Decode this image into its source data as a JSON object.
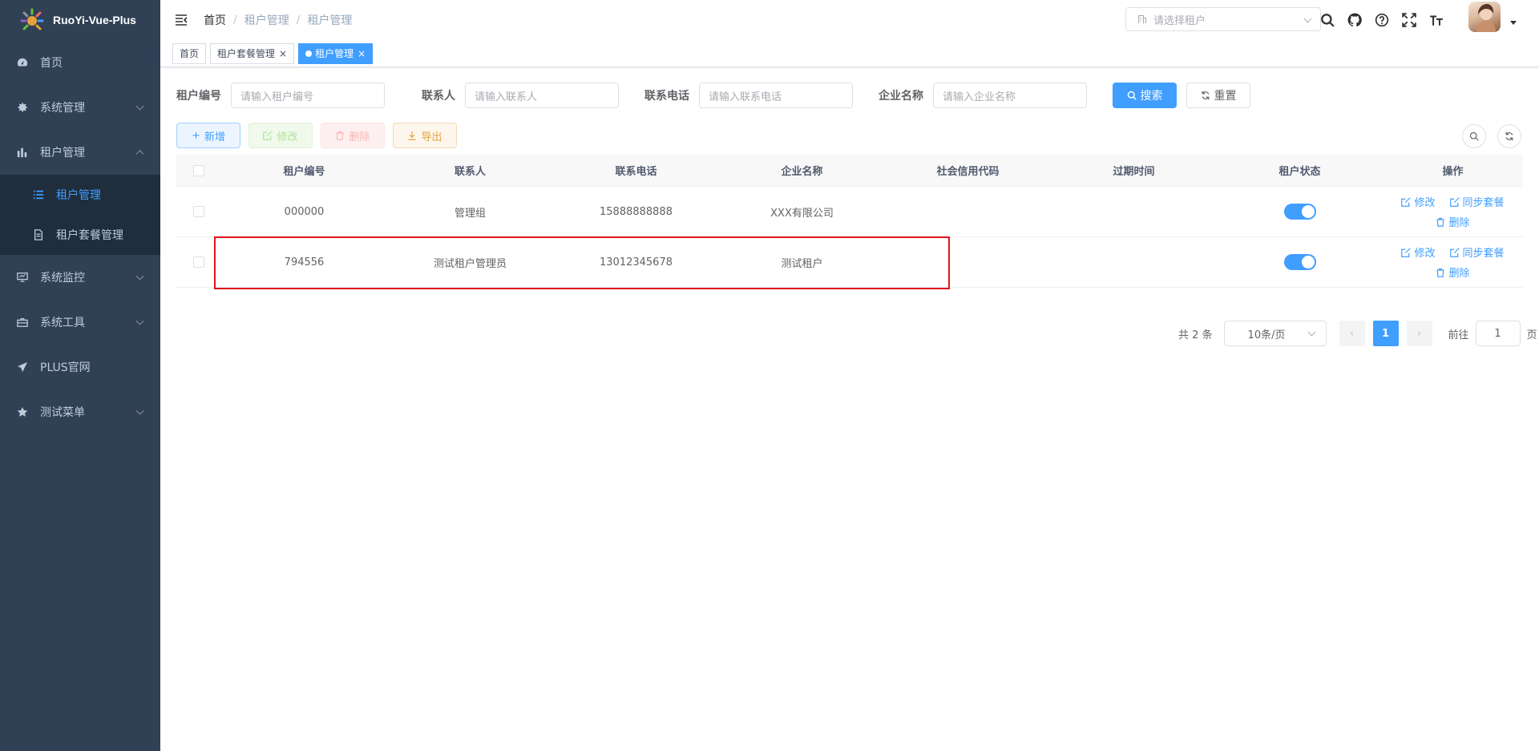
{
  "app": {
    "name": "RuoYi-Vue-Plus"
  },
  "sidebar": {
    "items": [
      {
        "label": "首页",
        "icon": "dashboard-icon"
      },
      {
        "label": "系统管理",
        "icon": "gear-icon"
      },
      {
        "label": "租户管理",
        "icon": "chart-icon",
        "expanded": true,
        "children": [
          {
            "label": "租户管理",
            "icon": "list-icon",
            "active": true
          },
          {
            "label": "租户套餐管理",
            "icon": "document-icon"
          }
        ]
      },
      {
        "label": "系统监控",
        "icon": "monitor-icon"
      },
      {
        "label": "系统工具",
        "icon": "toolbox-icon"
      },
      {
        "label": "PLUS官网",
        "icon": "send-icon"
      },
      {
        "label": "测试菜单",
        "icon": "star-icon"
      }
    ]
  },
  "header": {
    "breadcrumb": [
      "首页",
      "租户管理",
      "租户管理"
    ],
    "breadcrumb_sep": "/",
    "tenant_placeholder": "请选择租户"
  },
  "tags": [
    {
      "label": "首页"
    },
    {
      "label": "租户套餐管理",
      "closable": true
    },
    {
      "label": "租户管理",
      "closable": true,
      "active": true
    }
  ],
  "search": {
    "fields": [
      {
        "label": "租户编号",
        "placeholder": "请输入租户编号"
      },
      {
        "label": "联系人",
        "placeholder": "请输入联系人"
      },
      {
        "label": "联系电话",
        "placeholder": "请输入联系电话"
      },
      {
        "label": "企业名称",
        "placeholder": "请输入企业名称"
      }
    ],
    "search_label": "搜索",
    "reset_label": "重置"
  },
  "toolbar": {
    "add": "新增",
    "edit": "修改",
    "delete": "删除",
    "export": "导出"
  },
  "table": {
    "columns": [
      "租户编号",
      "联系人",
      "联系电话",
      "企业名称",
      "社会信用代码",
      "过期时间",
      "租户状态",
      "操作"
    ],
    "rows": [
      {
        "id": "000000",
        "contact": "管理组",
        "phone": "15888888888",
        "company": "XXX有限公司",
        "credit": "",
        "expire": "",
        "status": true
      },
      {
        "id": "794556",
        "contact": "测试租户管理员",
        "phone": "13012345678",
        "company": "测试租户",
        "credit": "",
        "expire": "",
        "status": true
      }
    ],
    "ops": {
      "edit": "修改",
      "sync": "同步套餐",
      "delete": "删除"
    }
  },
  "pagination": {
    "total_text": "共 2 条",
    "page_size": "10条/页",
    "current_page": "1",
    "goto_label": "前往",
    "goto_value": "1",
    "page_suffix": "页"
  },
  "colors": {
    "primary": "#409eff",
    "sidebar_bg": "#304156",
    "submenu_bg": "#1f2d3d",
    "highlight": "#e0141e"
  }
}
